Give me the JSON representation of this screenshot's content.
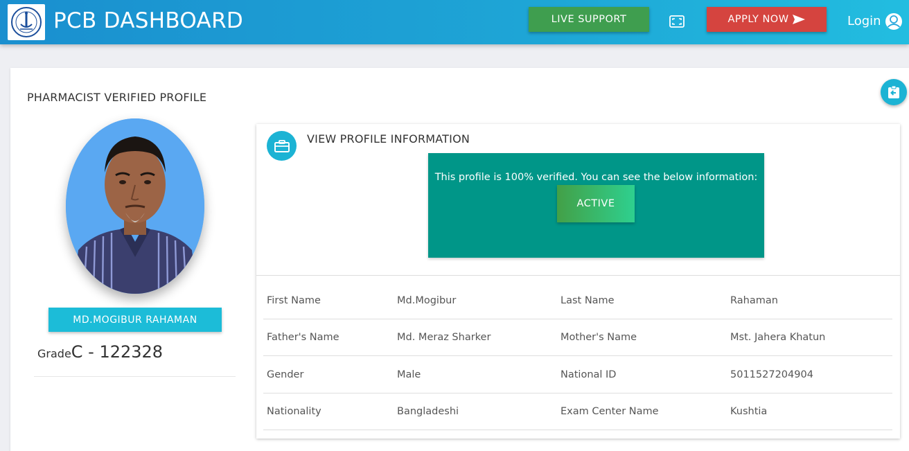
{
  "header": {
    "brand": "PCB DASHBOARD",
    "live_support": "LIVE SUPPORT",
    "apply_now": "APPLY NOW",
    "login": "Login"
  },
  "page": {
    "title": "PHARMACIST VERIFIED PROFILE"
  },
  "profile": {
    "name": "MD.MOGIBUR RAHAMAN",
    "grade_label": "Grade",
    "grade_value": "C - 122328"
  },
  "info": {
    "title": "VIEW PROFILE INFORMATION",
    "verify_message": "This profile is 100% verified. You can see the below information:",
    "status": "ACTIVE",
    "rows": [
      {
        "label1": "First Name",
        "value1": "Md.Mogibur",
        "label2": "Last Name",
        "value2": "Rahaman"
      },
      {
        "label1": "Father's Name",
        "value1": "Md. Meraz Sharker",
        "label2": "Mother's Name",
        "value2": "Mst. Jahera Khatun"
      },
      {
        "label1": "Gender",
        "value1": "Male",
        "label2": "National ID",
        "value2": "5011527204904"
      },
      {
        "label1": "Nationality",
        "value1": "Bangladeshi",
        "label2": "Exam Center Name",
        "value2": "Kushtia"
      }
    ]
  },
  "icons": {
    "logo": "council-seal-logo",
    "fullscreen": "fullscreen-icon",
    "send": "send-icon",
    "user": "user-icon",
    "back": "clipboard-back-icon",
    "briefcase": "briefcase-icon"
  },
  "colors": {
    "header_start": "#1a8fcf",
    "header_end": "#22bde0",
    "live_support": "#3f9e4f",
    "apply_now": "#d5443f",
    "accent": "#1cb3d4",
    "verify_box": "#009688",
    "active_start": "#43a047",
    "active_end": "#2ed08f"
  }
}
